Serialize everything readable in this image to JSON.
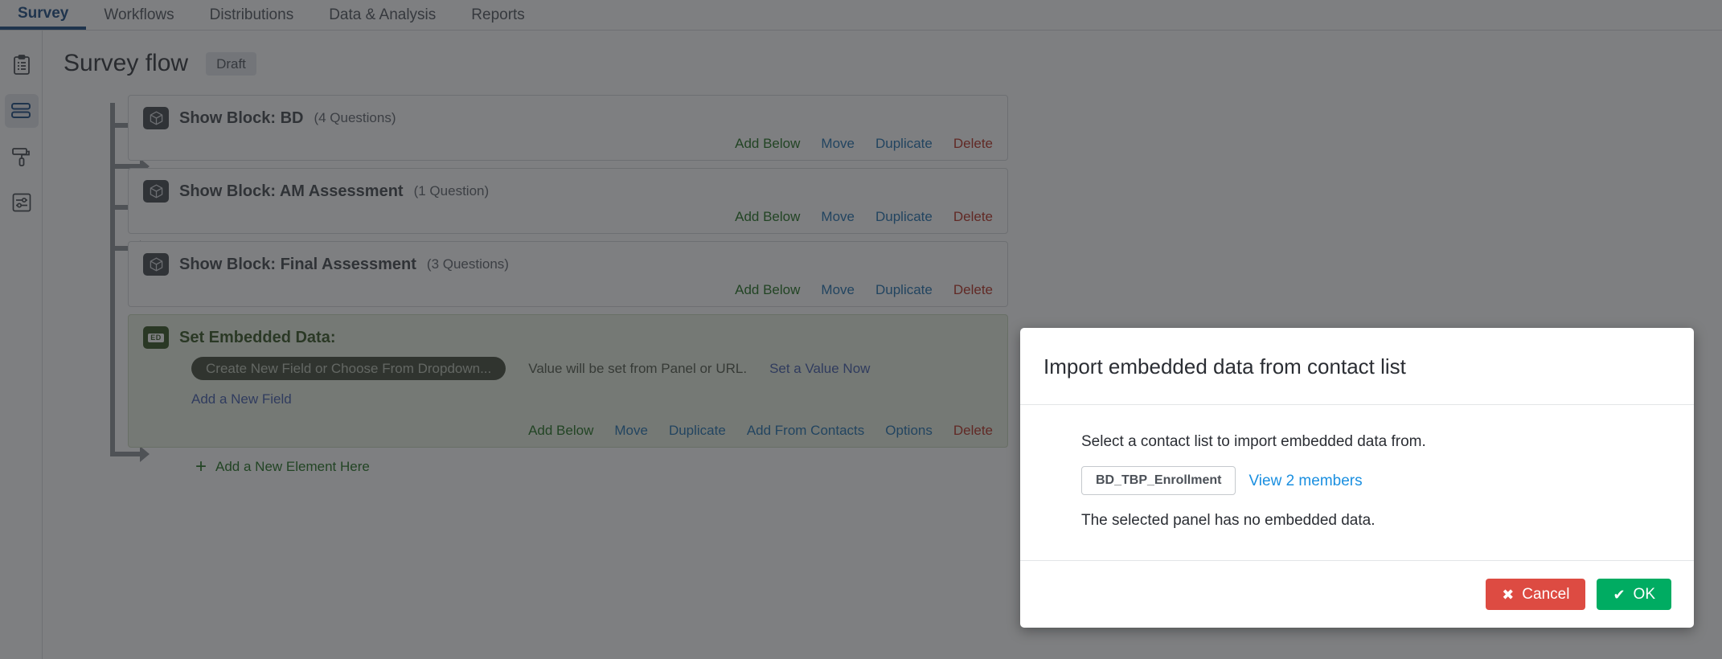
{
  "topnav": {
    "items": [
      {
        "label": "Survey",
        "active": true
      },
      {
        "label": "Workflows",
        "active": false
      },
      {
        "label": "Distributions",
        "active": false
      },
      {
        "label": "Data & Analysis",
        "active": false
      },
      {
        "label": "Reports",
        "active": false
      }
    ]
  },
  "rail": {
    "items": [
      {
        "icon": "clipboard-icon",
        "active": false
      },
      {
        "icon": "survey-flow-icon",
        "active": true
      },
      {
        "icon": "paint-roller-icon",
        "active": false
      },
      {
        "icon": "survey-options-icon",
        "active": false
      }
    ]
  },
  "page": {
    "title": "Survey flow",
    "status": "Draft"
  },
  "flow": {
    "blocks": [
      {
        "type": "show-block",
        "icon": "cube-icon",
        "title": "Show Block: BD",
        "count": "(4 Questions)"
      },
      {
        "type": "show-block",
        "icon": "cube-icon",
        "title": "Show Block: AM Assessment",
        "count": "(1 Question)"
      },
      {
        "type": "show-block",
        "icon": "cube-icon",
        "title": "Show Block: Final Assessment",
        "count": "(3 Questions)"
      }
    ],
    "block_actions": [
      {
        "label": "Add Below",
        "kind": "add"
      },
      {
        "label": "Move",
        "kind": "link"
      },
      {
        "label": "Duplicate",
        "kind": "link"
      },
      {
        "label": "Delete",
        "kind": "del"
      }
    ],
    "embedded": {
      "icon": "ED",
      "title": "Set Embedded Data:",
      "field_pill": "Create New Field or Choose From Dropdown...",
      "value_note": "Value will be set from Panel or URL.",
      "set_value_link": "Set a Value Now",
      "add_field_link": "Add a New Field",
      "actions": [
        {
          "label": "Add Below",
          "kind": "add"
        },
        {
          "label": "Move",
          "kind": "link"
        },
        {
          "label": "Duplicate",
          "kind": "link"
        },
        {
          "label": "Add From Contacts",
          "kind": "link"
        },
        {
          "label": "Options",
          "kind": "link"
        },
        {
          "label": "Delete",
          "kind": "del"
        }
      ]
    },
    "add_element": "Add a New Element Here",
    "add_element_plus": "+"
  },
  "modal": {
    "title": "Import embedded data from contact list",
    "instruction": "Select a contact list to import embedded data from.",
    "contact_list": "BD_TBP_Enrollment",
    "view_members_link": "View 2 members",
    "no_data_message": "The selected panel has no embedded data.",
    "cancel_label": "Cancel",
    "cancel_icon": "✖",
    "ok_label": "OK",
    "ok_icon": "✔"
  },
  "colors": {
    "accent_blue": "#13447e",
    "link_blue": "#1a6dad",
    "link_green": "#1a6d18",
    "link_red": "#b62a1a",
    "cancel_red": "#dd4b42",
    "ok_green": "#00ac62",
    "embedded_bg": "#e9f0e1"
  }
}
